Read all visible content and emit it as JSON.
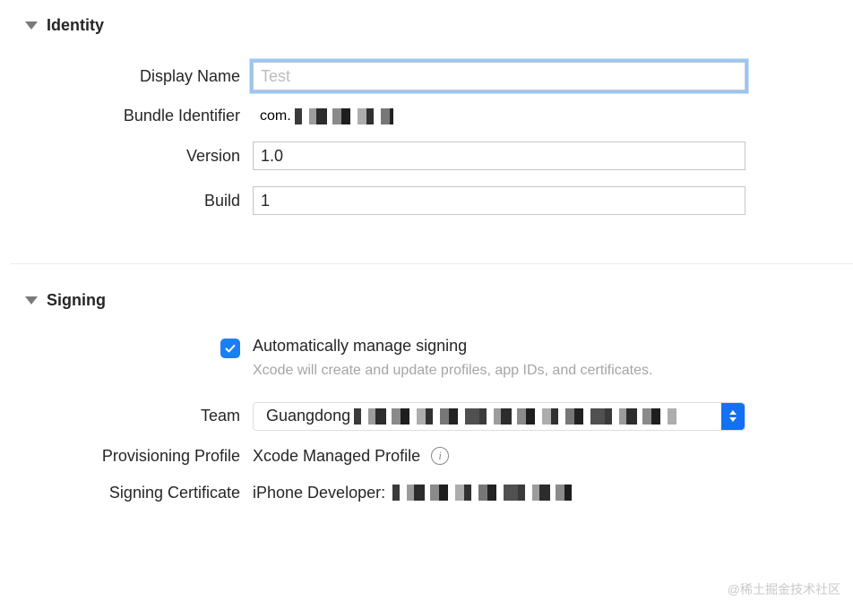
{
  "identity": {
    "section_title": "Identity",
    "display_name_label": "Display Name",
    "display_name_value": "",
    "display_name_placeholder": "Test",
    "bundle_id_label": "Bundle Identifier",
    "bundle_id_prefix": "com.",
    "version_label": "Version",
    "version_value": "1.0",
    "build_label": "Build",
    "build_value": "1"
  },
  "signing": {
    "section_title": "Signing",
    "auto_manage_checked": true,
    "auto_manage_label": "Automatically manage signing",
    "auto_manage_desc": "Xcode will create and update profiles, app IDs, and certificates.",
    "team_label": "Team",
    "team_selected_prefix": "Guangdong",
    "provisioning_label": "Provisioning Profile",
    "provisioning_value": "Xcode Managed Profile",
    "certificate_label": "Signing Certificate",
    "certificate_value_prefix": "iPhone Developer:"
  },
  "watermark": "@稀土掘金技术社区"
}
